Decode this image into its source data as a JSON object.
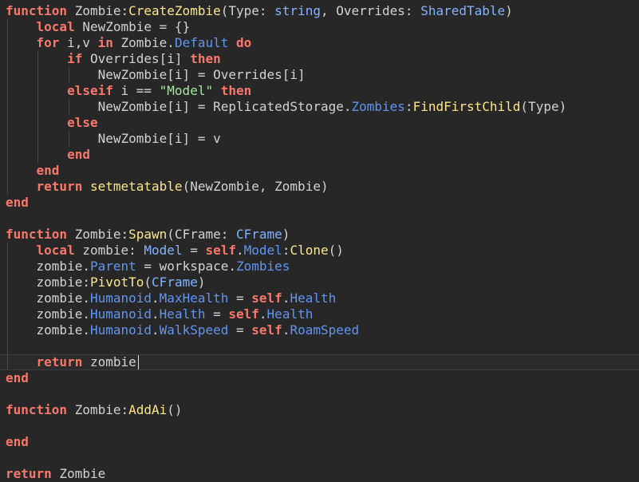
{
  "lines": [
    [
      {
        "t": "function",
        "c": "kw"
      },
      {
        "t": " Zombie:",
        "c": "tx"
      },
      {
        "t": "CreateZombie",
        "c": "fn"
      },
      {
        "t": "(Type: ",
        "c": "tx"
      },
      {
        "t": "string",
        "c": "ty"
      },
      {
        "t": ", Overrides: ",
        "c": "tx"
      },
      {
        "t": "SharedTable",
        "c": "ty"
      },
      {
        "t": ")",
        "c": "tx"
      }
    ],
    [
      {
        "t": "    ",
        "c": "tx"
      },
      {
        "t": "local",
        "c": "kw"
      },
      {
        "t": " NewZombie = {}",
        "c": "tx"
      }
    ],
    [
      {
        "t": "    ",
        "c": "tx"
      },
      {
        "t": "for",
        "c": "kw"
      },
      {
        "t": " i,v ",
        "c": "tx"
      },
      {
        "t": "in",
        "c": "kw"
      },
      {
        "t": " Zombie.",
        "c": "tx"
      },
      {
        "t": "Default",
        "c": "pr"
      },
      {
        "t": " ",
        "c": "tx"
      },
      {
        "t": "do",
        "c": "kw"
      }
    ],
    [
      {
        "t": "        ",
        "c": "tx"
      },
      {
        "t": "if",
        "c": "kw"
      },
      {
        "t": " Overrides[i] ",
        "c": "tx"
      },
      {
        "t": "then",
        "c": "kw"
      }
    ],
    [
      {
        "t": "            NewZombie[i] = Overrides[i]",
        "c": "tx"
      }
    ],
    [
      {
        "t": "        ",
        "c": "tx"
      },
      {
        "t": "elseif",
        "c": "kw"
      },
      {
        "t": " i == ",
        "c": "tx"
      },
      {
        "t": "\"Model\"",
        "c": "st"
      },
      {
        "t": " ",
        "c": "tx"
      },
      {
        "t": "then",
        "c": "kw"
      }
    ],
    [
      {
        "t": "            NewZombie[i] = ReplicatedStorage.",
        "c": "tx"
      },
      {
        "t": "Zombies",
        "c": "pr"
      },
      {
        "t": ":",
        "c": "tx"
      },
      {
        "t": "FindFirstChild",
        "c": "fn"
      },
      {
        "t": "(Type)",
        "c": "tx"
      }
    ],
    [
      {
        "t": "        ",
        "c": "tx"
      },
      {
        "t": "else",
        "c": "kw"
      }
    ],
    [
      {
        "t": "            NewZombie[i] = v",
        "c": "tx"
      }
    ],
    [
      {
        "t": "        ",
        "c": "tx"
      },
      {
        "t": "end",
        "c": "kw"
      }
    ],
    [
      {
        "t": "    ",
        "c": "tx"
      },
      {
        "t": "end",
        "c": "kw"
      }
    ],
    [
      {
        "t": "    ",
        "c": "tx"
      },
      {
        "t": "return",
        "c": "kw"
      },
      {
        "t": " ",
        "c": "tx"
      },
      {
        "t": "setmetatable",
        "c": "fn"
      },
      {
        "t": "(NewZombie, Zombie)",
        "c": "tx"
      }
    ],
    [
      {
        "t": "end",
        "c": "kw"
      }
    ],
    [],
    [
      {
        "t": "function",
        "c": "kw"
      },
      {
        "t": " Zombie:",
        "c": "tx"
      },
      {
        "t": "Spawn",
        "c": "fn"
      },
      {
        "t": "(CFrame: ",
        "c": "tx"
      },
      {
        "t": "CFrame",
        "c": "ty"
      },
      {
        "t": ")",
        "c": "tx"
      }
    ],
    [
      {
        "t": "    ",
        "c": "tx"
      },
      {
        "t": "local",
        "c": "kw"
      },
      {
        "t": " zombie: ",
        "c": "tx"
      },
      {
        "t": "Model",
        "c": "ty"
      },
      {
        "t": " = ",
        "c": "tx"
      },
      {
        "t": "self",
        "c": "kw"
      },
      {
        "t": ".",
        "c": "tx"
      },
      {
        "t": "Model",
        "c": "pr"
      },
      {
        "t": ":",
        "c": "tx"
      },
      {
        "t": "Clone",
        "c": "fn"
      },
      {
        "t": "()",
        "c": "tx"
      }
    ],
    [
      {
        "t": "    zombie.",
        "c": "tx"
      },
      {
        "t": "Parent",
        "c": "pr"
      },
      {
        "t": " = workspace.",
        "c": "tx"
      },
      {
        "t": "Zombies",
        "c": "pr"
      }
    ],
    [
      {
        "t": "    zombie:",
        "c": "tx"
      },
      {
        "t": "PivotTo",
        "c": "fn"
      },
      {
        "t": "(",
        "c": "tx"
      },
      {
        "t": "CFrame",
        "c": "ty"
      },
      {
        "t": ")",
        "c": "tx"
      }
    ],
    [
      {
        "t": "    zombie.",
        "c": "tx"
      },
      {
        "t": "Humanoid",
        "c": "pr"
      },
      {
        "t": ".",
        "c": "tx"
      },
      {
        "t": "MaxHealth",
        "c": "pr"
      },
      {
        "t": " = ",
        "c": "tx"
      },
      {
        "t": "self",
        "c": "kw"
      },
      {
        "t": ".",
        "c": "tx"
      },
      {
        "t": "Health",
        "c": "pr"
      }
    ],
    [
      {
        "t": "    zombie.",
        "c": "tx"
      },
      {
        "t": "Humanoid",
        "c": "pr"
      },
      {
        "t": ".",
        "c": "tx"
      },
      {
        "t": "Health",
        "c": "pr"
      },
      {
        "t": " = ",
        "c": "tx"
      },
      {
        "t": "self",
        "c": "kw"
      },
      {
        "t": ".",
        "c": "tx"
      },
      {
        "t": "Health",
        "c": "pr"
      }
    ],
    [
      {
        "t": "    zombie.",
        "c": "tx"
      },
      {
        "t": "Humanoid",
        "c": "pr"
      },
      {
        "t": ".",
        "c": "tx"
      },
      {
        "t": "WalkSpeed",
        "c": "pr"
      },
      {
        "t": " = ",
        "c": "tx"
      },
      {
        "t": "self",
        "c": "kw"
      },
      {
        "t": ".",
        "c": "tx"
      },
      {
        "t": "RoamSpeed",
        "c": "pr"
      }
    ],
    [],
    [
      {
        "t": "    ",
        "c": "tx"
      },
      {
        "t": "return",
        "c": "kw"
      },
      {
        "t": " zombie",
        "c": "tx"
      }
    ],
    [
      {
        "t": "end",
        "c": "kw"
      }
    ],
    [],
    [
      {
        "t": "function",
        "c": "kw"
      },
      {
        "t": " Zombie:",
        "c": "tx"
      },
      {
        "t": "AddAi",
        "c": "fn"
      },
      {
        "t": "()",
        "c": "tx"
      }
    ],
    [],
    [
      {
        "t": "end",
        "c": "kw"
      }
    ],
    [],
    [
      {
        "t": "return",
        "c": "kw"
      },
      {
        "t": " Zombie",
        "c": "tx"
      }
    ]
  ],
  "cursor_line": 23
}
